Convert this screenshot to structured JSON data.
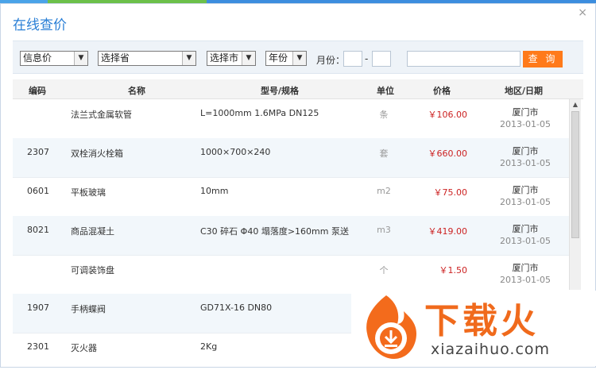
{
  "dialog": {
    "title": "在线查价",
    "close_glyph": "×"
  },
  "filters": {
    "type_select": "信息价",
    "province_select": "选择省",
    "city_select": "选择市",
    "year_select": "年份",
    "month_label": "月份：",
    "month_sep": "-",
    "search_button": "查 询"
  },
  "table": {
    "headers": [
      "编码",
      "名称",
      "型号/规格",
      "单位",
      "价格",
      "地区/日期"
    ],
    "rows": [
      {
        "code": "",
        "name": "法兰式金属软管",
        "spec": "L=1000mm 1.6MPa DN125",
        "unit": "条",
        "price": "￥106.00",
        "region": "厦门市",
        "date": "2013-01-05"
      },
      {
        "code": "2307",
        "name": "双栓消火栓箱",
        "spec": "1000×700×240",
        "unit": "套",
        "price": "￥660.00",
        "region": "厦门市",
        "date": "2013-01-05"
      },
      {
        "code": "0601",
        "name": "平板玻璃",
        "spec": "10mm",
        "unit": "m2",
        "price": "￥75.00",
        "region": "厦门市",
        "date": "2013-01-05"
      },
      {
        "code": "8021",
        "name": "商品混凝土",
        "spec": "C30 碎石 Φ40 塌落度>160mm 泵送",
        "unit": "m3",
        "price": "￥419.00",
        "region": "厦门市",
        "date": "2013-01-05"
      },
      {
        "code": "",
        "name": "可调装饰盘",
        "spec": "",
        "unit": "个",
        "price": "￥1.50",
        "region": "厦门市",
        "date": "2013-01-05"
      },
      {
        "code": "1907",
        "name": "手柄蝶阀",
        "spec": "GD71X-16 DN80",
        "unit": "",
        "price": "",
        "region": "",
        "date": ""
      },
      {
        "code": "2301",
        "name": "灭火器",
        "spec": "2Kg",
        "unit": "",
        "price": "",
        "region": "",
        "date": ""
      }
    ]
  },
  "watermark": {
    "brand": "下载火",
    "url": "xiazaihuo.com"
  }
}
